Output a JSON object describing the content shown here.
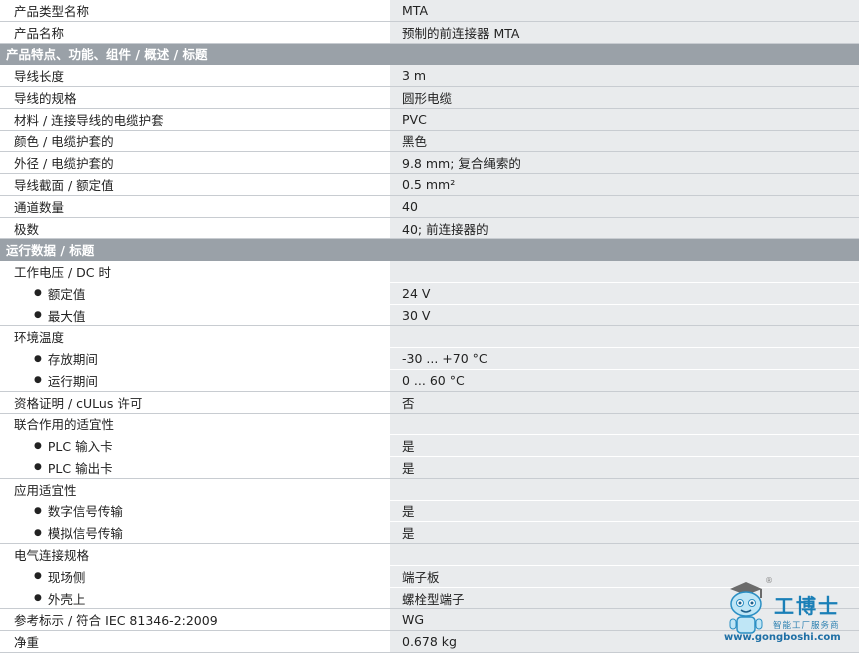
{
  "rows": [
    {
      "type": "row",
      "label": "产品类型名称",
      "value": "MTA"
    },
    {
      "type": "row",
      "label": "产品名称",
      "value": "预制的前连接器 MTA"
    },
    {
      "type": "section",
      "label": "产品特点、功能、组件 / 概述 / 标题"
    },
    {
      "type": "row",
      "label": "导线长度",
      "value": "3 m"
    },
    {
      "type": "row",
      "label": "导线的规格",
      "value": "圆形电缆"
    },
    {
      "type": "row",
      "label": "材料 / 连接导线的电缆护套",
      "value": "PVC"
    },
    {
      "type": "row",
      "label": "颜色 / 电缆护套的",
      "value": "黑色"
    },
    {
      "type": "row",
      "label": "外径 / 电缆护套的",
      "value": "9.8 mm; 复合绳索的"
    },
    {
      "type": "row",
      "label": "导线截面 / 额定值",
      "value": "0.5 mm²"
    },
    {
      "type": "row",
      "label": "通道数量",
      "value": "40"
    },
    {
      "type": "row",
      "label": "极数",
      "value": "40; 前连接器的"
    },
    {
      "type": "section",
      "label": "运行数据 / 标题"
    },
    {
      "type": "group",
      "label": "工作电压 / DC 时",
      "value": ""
    },
    {
      "type": "sub",
      "label": "额定值",
      "value": "24 V"
    },
    {
      "type": "sub-last",
      "label": "最大值",
      "value": "30 V"
    },
    {
      "type": "group",
      "label": "环境温度",
      "value": ""
    },
    {
      "type": "sub",
      "label": "存放期间",
      "value": "-30 ... +70 °C"
    },
    {
      "type": "sub-last",
      "label": "运行期间",
      "value": "0 ... 60 °C"
    },
    {
      "type": "row",
      "label": "资格证明 / cULus 许可",
      "value": "否"
    },
    {
      "type": "group",
      "label": "联合作用的适宜性",
      "value": ""
    },
    {
      "type": "sub",
      "label": "PLC 输入卡",
      "value": "是"
    },
    {
      "type": "sub-last",
      "label": "PLC 输出卡",
      "value": "是"
    },
    {
      "type": "group",
      "label": "应用适宜性",
      "value": ""
    },
    {
      "type": "sub",
      "label": "数字信号传输",
      "value": "是"
    },
    {
      "type": "sub-last",
      "label": "模拟信号传输",
      "value": "是"
    },
    {
      "type": "group",
      "label": "电气连接规格",
      "value": ""
    },
    {
      "type": "sub",
      "label": "现场侧",
      "value": "端子板"
    },
    {
      "type": "sub-last",
      "label": "外壳上",
      "value": "螺栓型端子"
    },
    {
      "type": "row",
      "label": "参考标示 / 符合 IEC 81346-2:2009",
      "value": "WG"
    },
    {
      "type": "row",
      "label": "净重",
      "value": "0.678 kg"
    }
  ],
  "watermark": {
    "registered_mark": "®",
    "brand": "工博士",
    "tagline": "智能工厂服务商",
    "site": "www.gongboshi.com"
  },
  "colors": {
    "section_header_bg": "#9aa1a8",
    "value_cell_bg": "#e9ebed",
    "border": "#c8ccd1",
    "watermark_blue": "#1a7fb7"
  }
}
